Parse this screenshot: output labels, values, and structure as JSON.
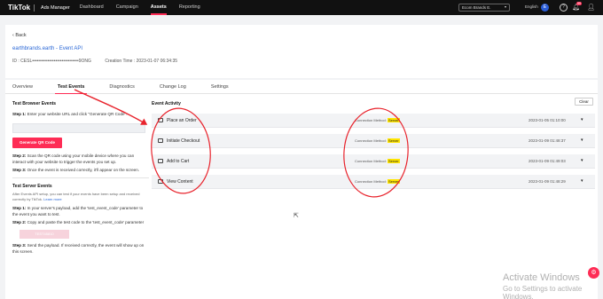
{
  "topbar": {
    "logo": "TikTok",
    "product": "Ads Manager",
    "nav": [
      "Dashboard",
      "Campaign",
      "Assets",
      "Reporting"
    ],
    "active_nav": "Assets",
    "account": "Ecom Brands E.",
    "language": "English",
    "avatar_letter": "E",
    "notification_count": "99"
  },
  "header": {
    "back_label": "Back",
    "api_name": "earthbrands.earth - Event API",
    "id_label": "ID : CESL••••••••••••••••••••••••••••••9ONG",
    "creation_time": "Creation Time : 2023-01-07 06:34:35"
  },
  "tabs": [
    "Overview",
    "Test Events",
    "Diagnostics",
    "Change Log",
    "Settings"
  ],
  "browser_events": {
    "title": "Test Browser Events",
    "step1_bold": "Step 1:",
    "step1": "Enter your website URL and click \"Generate QR Code\".",
    "generate_button": "Generate QR Code",
    "step2_bold": "Step 2:",
    "step2": "Scan the QR code using your mobile device where you can interact with your website to trigger the events you set up.",
    "step3_bold": "Step 3:",
    "step3": "Once the event is received correctly, it'll appear on the screen."
  },
  "server_events": {
    "title": "Test Server Events",
    "intro": "After Events API setup, you can test if your events have been setup and received correctly by TikTok.",
    "learn_more": "Learn more",
    "step1_bold": "Step 1:",
    "step1": "In your server's payload, add the 'test_event_code' parameter to the event you want to test.",
    "step2_bold": "Step 2:",
    "step2": "Copy and paste the test code to the 'test_event_code' parameter",
    "test_code": "TEST45810",
    "step3_bold": "Step 3:",
    "step3": "Send the payload. If received correctly, the event will show up on this screen."
  },
  "event_activity": {
    "title": "Event Activity",
    "clear_label": "Clear",
    "connection_label": "Connection Method:",
    "events": [
      {
        "name": "Place an Order",
        "method": "Server",
        "time": "2023-01-05 01:10:00"
      },
      {
        "name": "Initiate Checkout",
        "method": "Server",
        "time": "2023-01-09 01:48:37"
      },
      {
        "name": "Add to Cart",
        "method": "Server",
        "time": "2023-01-09 01:49:03"
      },
      {
        "name": "View Content",
        "method": "Server",
        "time": "2023-01-09 01:48:29"
      }
    ]
  },
  "watermark": {
    "title": "Activate Windows",
    "subtitle": "Go to Settings to activate Windows."
  },
  "colors": {
    "brand": "#fe2c55",
    "annotation": "#e8232c",
    "highlight": "#ffe500",
    "link": "#2a67d6"
  }
}
